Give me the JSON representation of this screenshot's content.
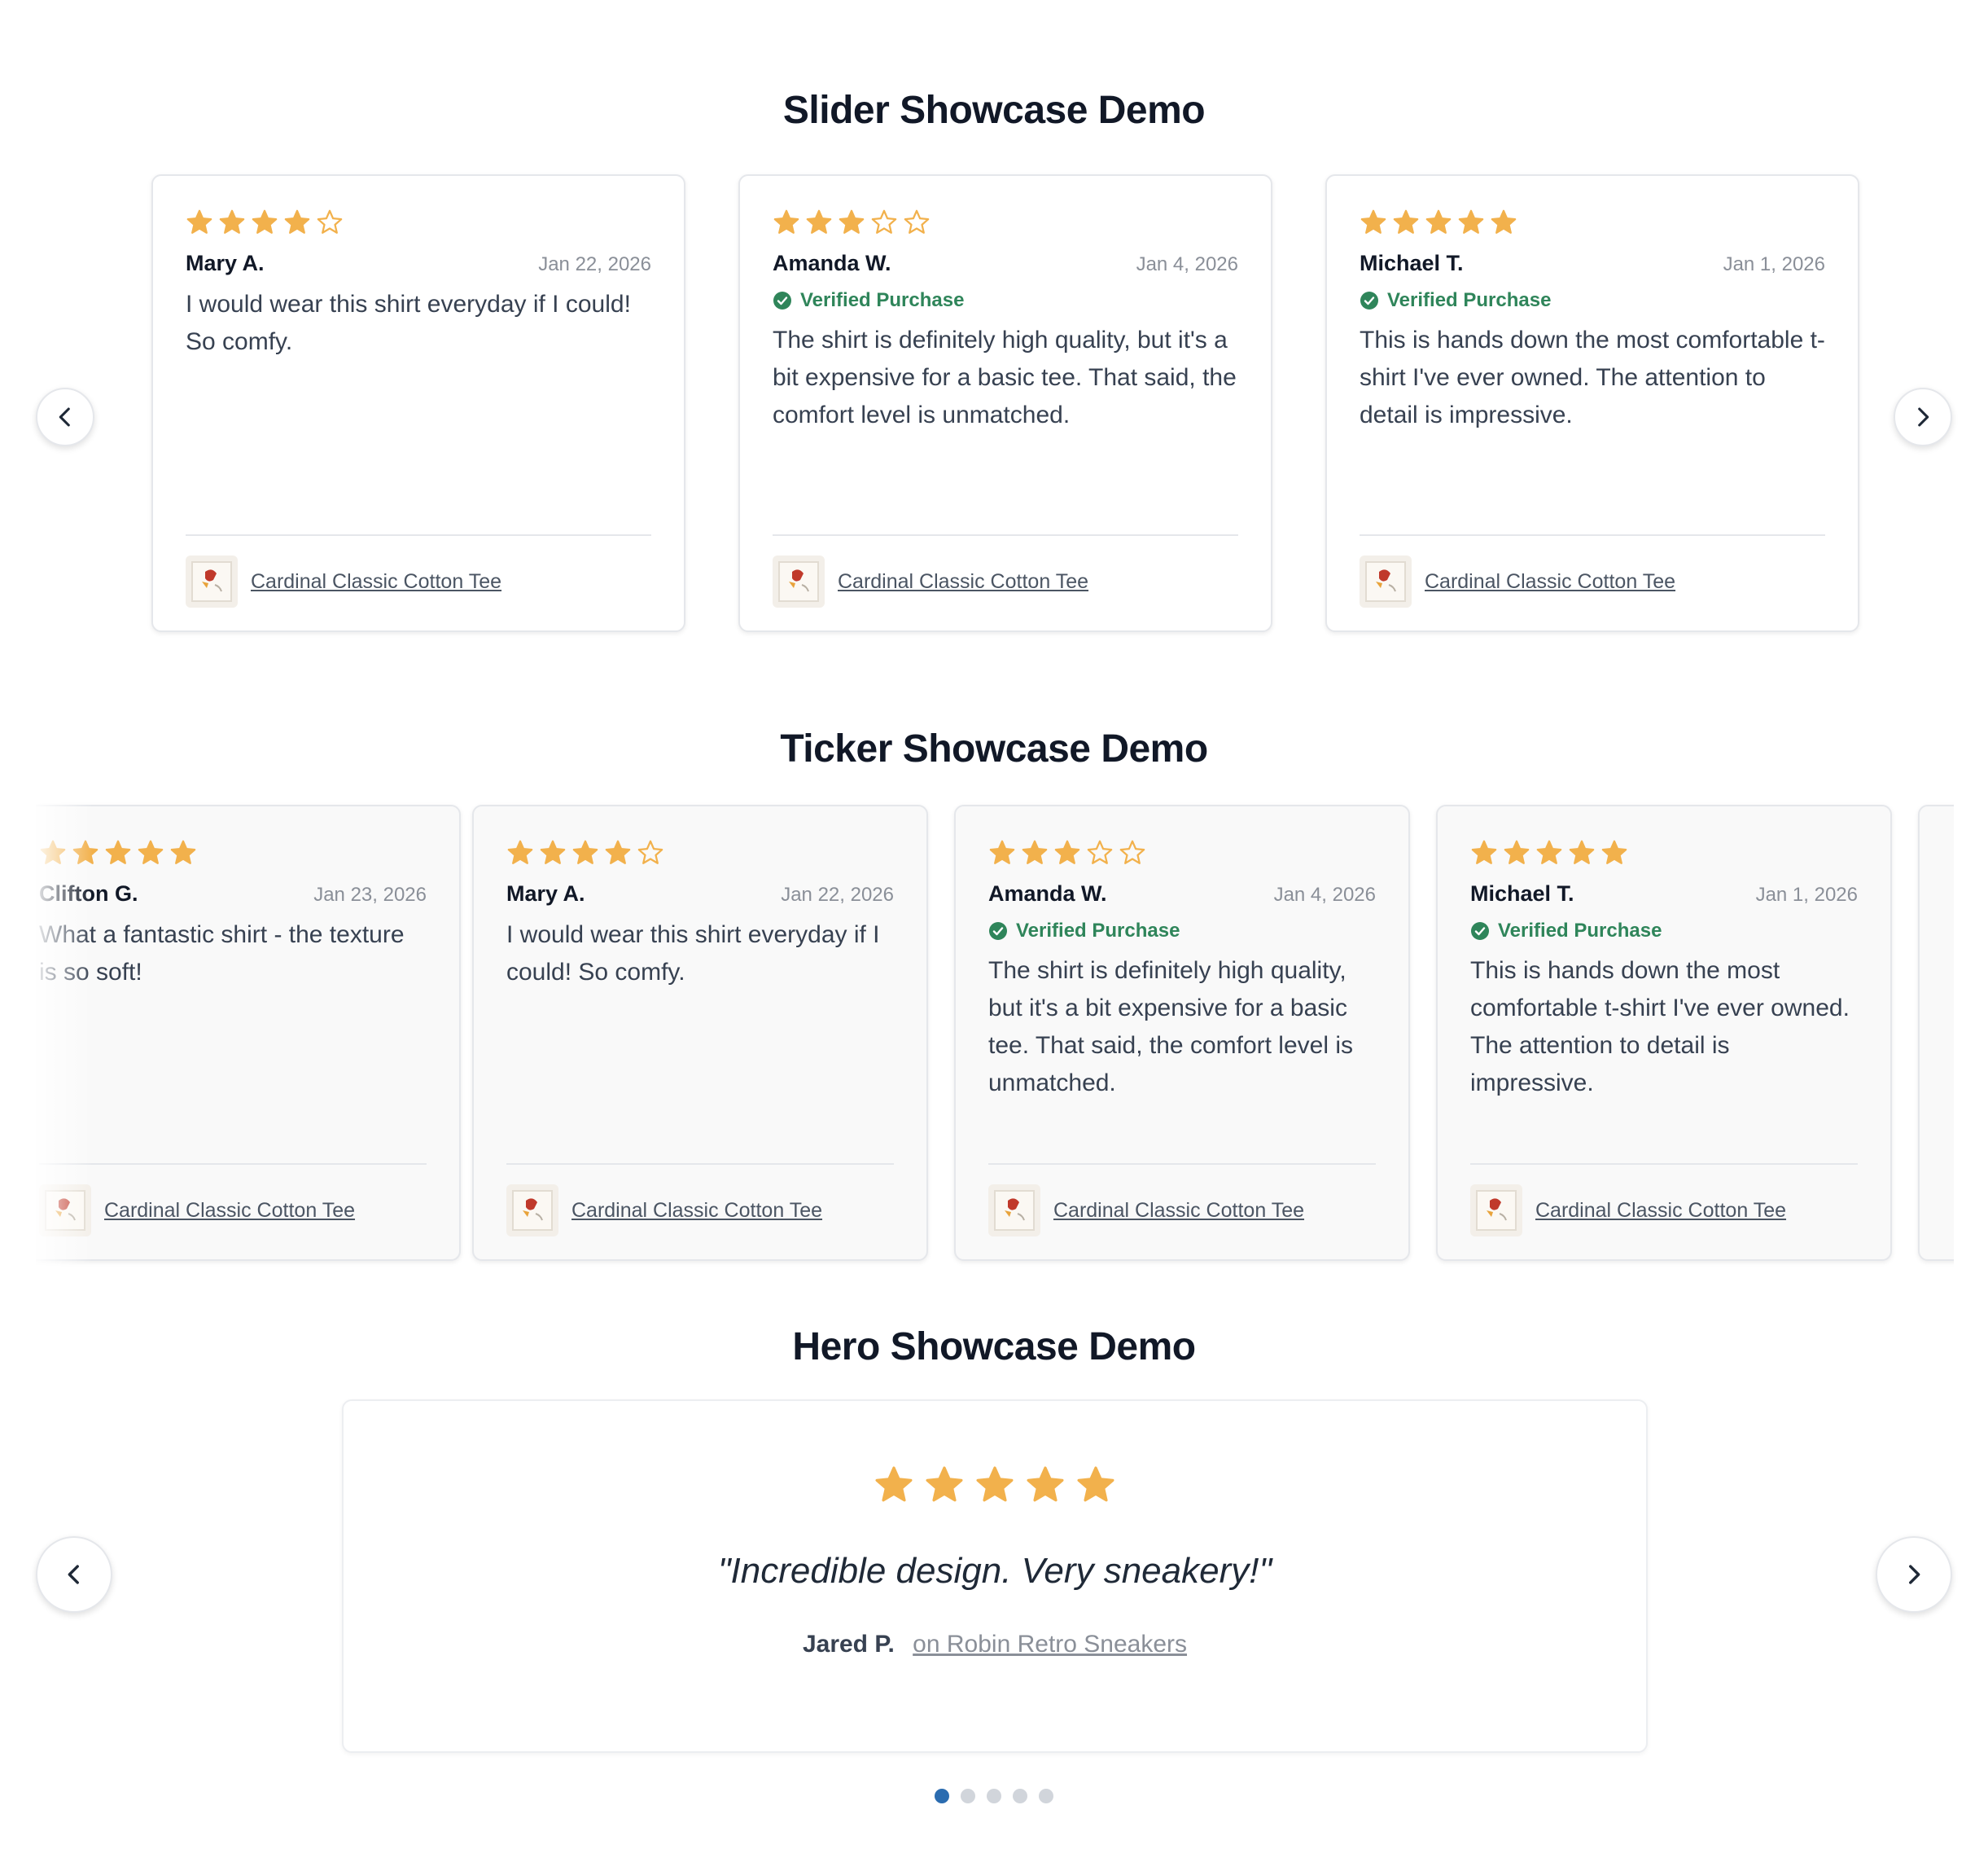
{
  "sections": {
    "slider_title": "Slider Showcase Demo",
    "ticker_title": "Ticker Showcase Demo",
    "hero_title": "Hero Showcase Demo"
  },
  "colors": {
    "star": "#f2b14c",
    "star_empty": "#f2b14c",
    "verified": "#2f855a",
    "dot_active": "#2b6cb0"
  },
  "slider": {
    "prev_icon": "chevron-left-icon",
    "next_icon": "chevron-right-icon",
    "cards": [
      {
        "rating": 4,
        "name": "Mary A.",
        "date": "Jan 22, 2026",
        "verified": false,
        "verified_label": "",
        "text": "I would wear this shirt everyday if I could! So comfy.",
        "product": "Cardinal Classic Cotton Tee"
      },
      {
        "rating": 3,
        "name": "Amanda W.",
        "date": "Jan 4, 2026",
        "verified": true,
        "verified_label": "Verified Purchase",
        "text": "The shirt is definitely high quality, but it's a bit expensive for a basic tee. That said, the comfort level is unmatched.",
        "product": "Cardinal Classic Cotton Tee"
      },
      {
        "rating": 5,
        "name": "Michael T.",
        "date": "Jan 1, 2026",
        "verified": true,
        "verified_label": "Verified Purchase",
        "text": "This is hands down the most comfortable t-shirt I've ever owned. The attention to detail is impressive.",
        "product": "Cardinal Classic Cotton Tee"
      }
    ]
  },
  "ticker": {
    "cards": [
      {
        "rating": 5,
        "name": "Clifton G.",
        "date": "Jan 23, 2026",
        "verified": false,
        "verified_label": "",
        "text": "What a fantastic shirt - the texture is so soft!",
        "product": "Cardinal Classic Cotton Tee"
      },
      {
        "rating": 4,
        "name": "Mary A.",
        "date": "Jan 22, 2026",
        "verified": false,
        "verified_label": "",
        "text": "I would wear this shirt everyday if I could! So comfy.",
        "product": "Cardinal Classic Cotton Tee"
      },
      {
        "rating": 3,
        "name": "Amanda W.",
        "date": "Jan 4, 2026",
        "verified": true,
        "verified_label": "Verified Purchase",
        "text": "The shirt is definitely high quality, but it's a bit expensive for a basic tee. That said, the comfort level is unmatched.",
        "product": "Cardinal Classic Cotton Tee"
      },
      {
        "rating": 5,
        "name": "Michael T.",
        "date": "Jan 1, 2026",
        "verified": true,
        "verified_label": "Verified Purchase",
        "text": "This is hands down the most comfortable t-shirt I've ever owned. The attention to detail is impressive.",
        "product": "Cardinal Classic Cotton Tee"
      }
    ]
  },
  "hero": {
    "rating": 5,
    "quote": "\"Incredible design. Very sneakery!\"",
    "name": "Jared P.",
    "product": "on Robin Retro Sneakers",
    "dots_total": 5,
    "dots_active": 1
  }
}
